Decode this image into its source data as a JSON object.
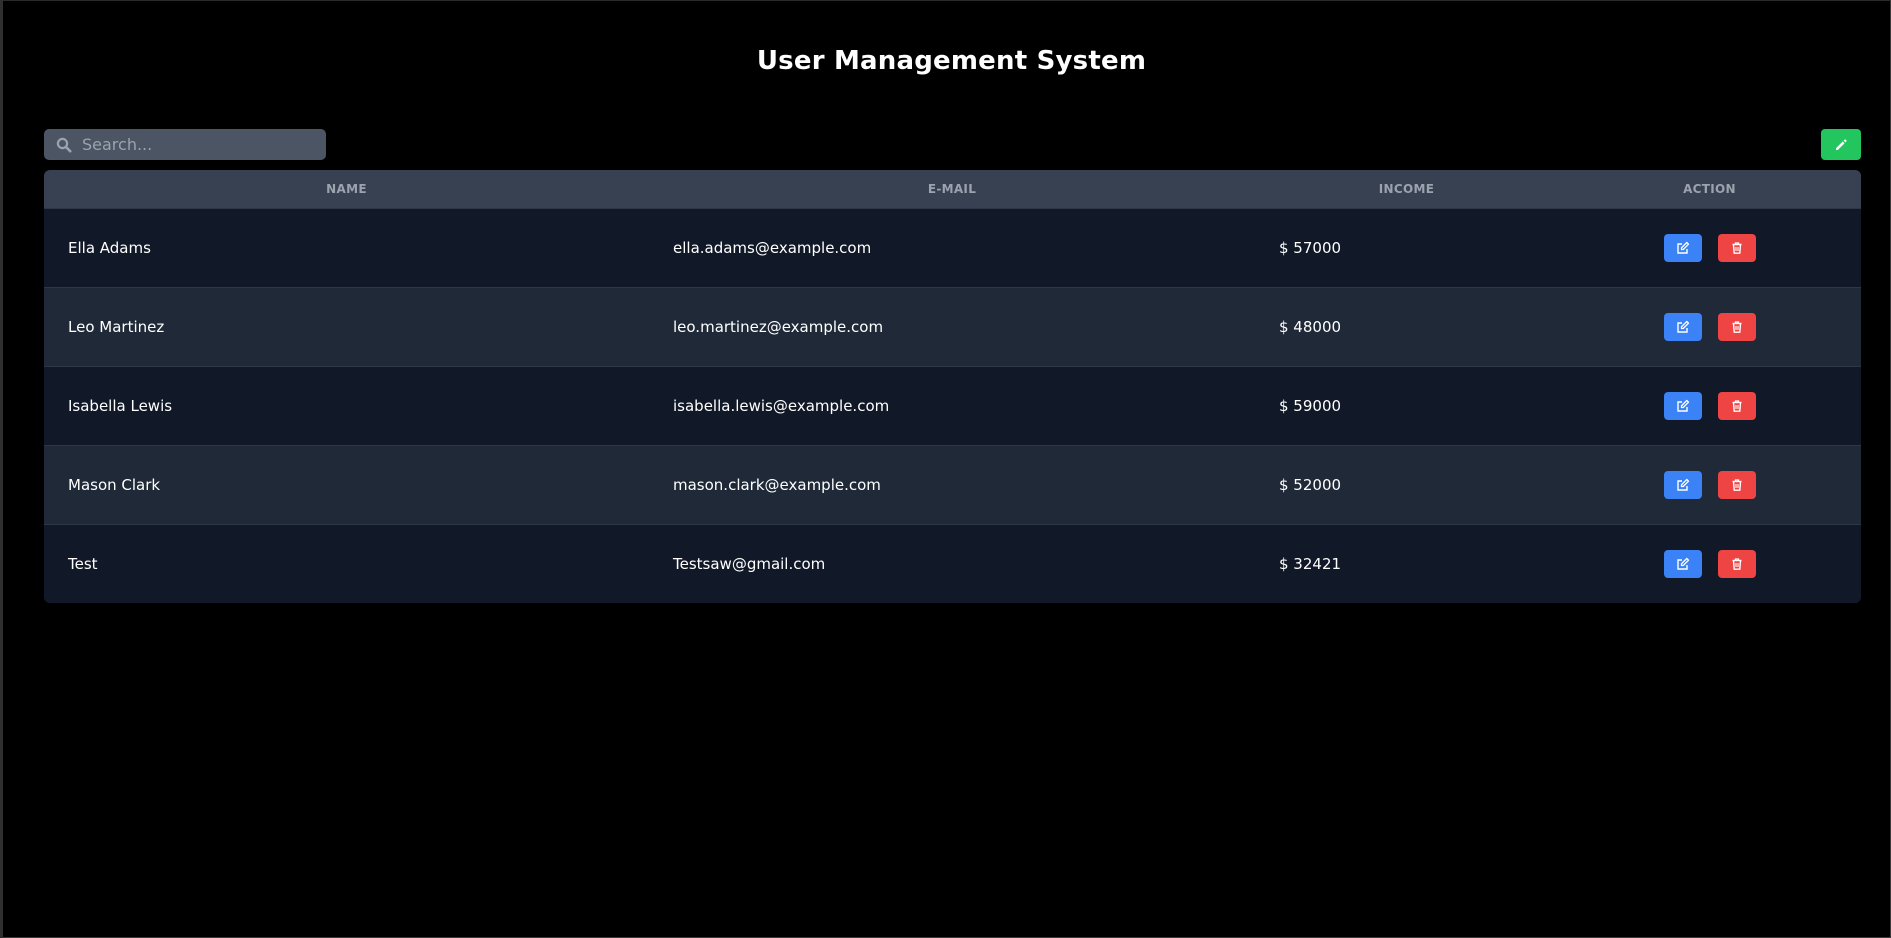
{
  "title": "User Management System",
  "search": {
    "placeholder": "Search..."
  },
  "table": {
    "headers": {
      "name": "NAME",
      "email": "E-MAIL",
      "income": "INCOME",
      "action": "ACTION"
    },
    "rows": [
      {
        "name": "Ella Adams",
        "email": "ella.adams@example.com",
        "income": "$ 57000"
      },
      {
        "name": "Leo Martinez",
        "email": "leo.martinez@example.com",
        "income": "$ 48000"
      },
      {
        "name": "Isabella Lewis",
        "email": "isabella.lewis@example.com",
        "income": "$ 59000"
      },
      {
        "name": "Mason Clark",
        "email": "mason.clark@example.com",
        "income": "$ 52000"
      },
      {
        "name": "Test",
        "email": "Testsaw@gmail.com",
        "income": "$ 32421"
      }
    ]
  },
  "icons": {
    "search": "search-icon",
    "add": "pencil-icon",
    "edit": "edit-icon",
    "delete": "trash-icon"
  },
  "colors": {
    "background": "#000000",
    "table_header": "#374151",
    "row_dark": "#111827",
    "row_light": "#1f2937",
    "search_bg": "#4b5563",
    "add_button": "#22c55e",
    "edit_button": "#3b82f6",
    "delete_button": "#ef4444"
  }
}
